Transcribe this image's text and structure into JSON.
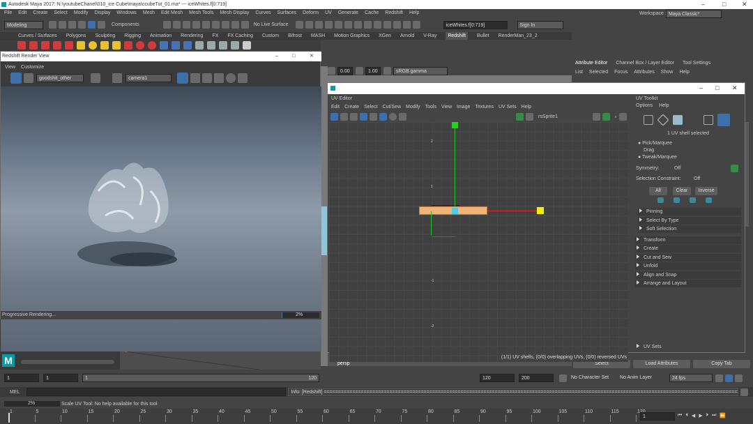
{
  "app": {
    "title": "Autodesk Maya 2017: N:\\youtubeChanel\\010_ice Cube\\maya\\ccubeTut_01.ma* --- iceWhites.f[0:719]",
    "window_controls": [
      "–",
      "□",
      "✕"
    ]
  },
  "menubar": [
    "File",
    "Edit",
    "Create",
    "Select",
    "Modify",
    "Display",
    "Windows",
    "Mesh",
    "Edit Mesh",
    "Mesh Tools",
    "Mesh Display",
    "Curves",
    "Surfaces",
    "Deform",
    "UV",
    "Generate",
    "Cache",
    "Redshift",
    "Help"
  ],
  "workspace": {
    "label": "Workspace :",
    "value": "Maya Classic*"
  },
  "statusline": {
    "mode": "Modeling",
    "components": "Components",
    "live": "No Live Surface",
    "input": "iceWhites.f[0:719]",
    "signin": "Sign In"
  },
  "shelf_tabs": [
    "Curves / Surfaces",
    "Polygons",
    "Sculpting",
    "Rigging",
    "Animation",
    "Rendering",
    "FX",
    "FX Caching",
    "Custom",
    "Bifrost",
    "MASH",
    "Motion Graphics",
    "XGen",
    "Arnold",
    "V-Ray",
    "Redshift",
    "Bullet",
    "RenderMan_23_2"
  ],
  "render_view": {
    "title": "Redshift Render View",
    "menu": [
      "View",
      "Customize"
    ],
    "preset": "goodshit_other",
    "camera": "camera1",
    "status": "Progressive Rendering...",
    "progress_text": "2%",
    "progress": 0.02
  },
  "viewport": {
    "exposure": "0.00",
    "gamma": "1.00",
    "color_space": "sRGB gamma",
    "camera_label": "persp"
  },
  "attribute_editor": {
    "tabs": [
      "Attribute Editor",
      "Channel Box / Layer Editor",
      "Tool Settings"
    ],
    "menu": [
      "List",
      "Selected",
      "Focus",
      "Attributes",
      "Show",
      "Help"
    ],
    "buttons": [
      "Select",
      "Load Attributes",
      "Copy Tab"
    ]
  },
  "uv_editor": {
    "title": "UV Editor",
    "menu": [
      "Edit",
      "Create",
      "Select",
      "Cut/Sew",
      "Modify",
      "Tools",
      "View",
      "Image",
      "Textures",
      "UV Sets",
      "Help"
    ],
    "texture": "rsSprite1",
    "status": "(1/1) UV shells, (0/0) overlapping UVs, (0/0) reversed UVs",
    "axis_labels": [
      "2",
      "1",
      "-1",
      "-2"
    ]
  },
  "uv_toolkit": {
    "title": "UV Toolkit",
    "menu": [
      "Options",
      "Help"
    ],
    "selected": "1 UV shell selected",
    "modes": [
      "Pick/Marquee",
      "Drag",
      "Tweak/Marquee"
    ],
    "symmetry": {
      "label": "Symmetry:",
      "value": "Off"
    },
    "constraint": {
      "label": "Selection Constraint:",
      "value": "Off"
    },
    "buttons": [
      "All",
      "Clear",
      "Inverse"
    ],
    "sections": [
      "Pinning",
      "Select By Type",
      "Soft Selection",
      "Transform",
      "Create",
      "Cut and Sew",
      "Unfold",
      "Align and Snap",
      "Arrange and Layout",
      "UV Sets"
    ]
  },
  "range": {
    "start": "1",
    "start2": "1",
    "current": "1",
    "end": "120",
    "end2": "120",
    "max": "200",
    "character_set": "No Character Set",
    "anim_layer": "No Anim Layer",
    "fps": "24 fps"
  },
  "command": {
    "lang": "MEL",
    "info": "Info: [Redshift] =================================================================================================================================================="
  },
  "help_line": {
    "progress": "2%",
    "text": "Scale UV Tool: No help available for this tool"
  },
  "timeline": {
    "ticks": [
      "1",
      "5",
      "10",
      "15",
      "20",
      "25",
      "30",
      "35",
      "40",
      "45",
      "50",
      "55",
      "60",
      "65",
      "70",
      "75",
      "80",
      "85",
      "90",
      "95",
      "100",
      "105",
      "110",
      "115",
      "120"
    ],
    "frame": "1"
  }
}
